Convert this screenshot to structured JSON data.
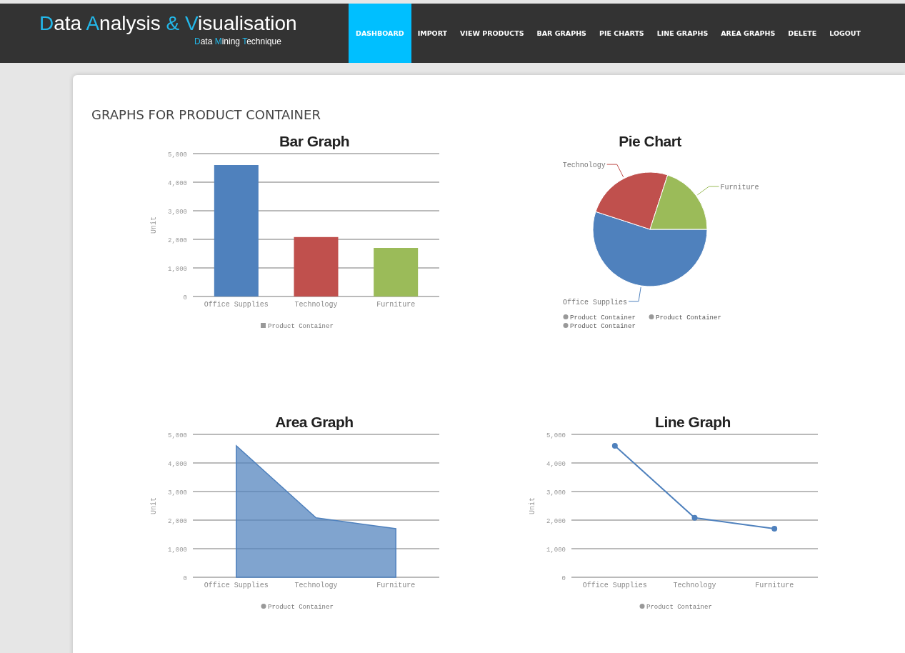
{
  "header": {
    "brand_parts": [
      {
        "text": "D",
        "accent": true
      },
      {
        "text": "ata ",
        "accent": false
      },
      {
        "text": "A",
        "accent": true
      },
      {
        "text": "nalysis ",
        "accent": false
      },
      {
        "text": "& ",
        "accent": true
      },
      {
        "text": "V",
        "accent": true
      },
      {
        "text": "isualisation",
        "accent": false
      }
    ],
    "tagline_parts": [
      {
        "text": "D",
        "accent": true
      },
      {
        "text": "ata ",
        "accent": false
      },
      {
        "text": "M",
        "accent": true
      },
      {
        "text": "ining ",
        "accent": false
      },
      {
        "text": "T",
        "accent": true
      },
      {
        "text": "echnique",
        "accent": false
      }
    ]
  },
  "nav": [
    {
      "label": "DASHBOARD",
      "selected": true
    },
    {
      "label": "IMPORT",
      "selected": false
    },
    {
      "label": "VIEW PRODUCTS",
      "selected": false
    },
    {
      "label": "BAR GRAPHS",
      "selected": false
    },
    {
      "label": "PIE CHARTS",
      "selected": false
    },
    {
      "label": "LINE GRAPHS",
      "selected": false
    },
    {
      "label": "AREA GRAPHS",
      "selected": false
    },
    {
      "label": "DELETE",
      "selected": false
    },
    {
      "label": "LOGOUT",
      "selected": false
    }
  ],
  "heading": "GRAPHS FOR PRODUCT CONTAINER",
  "charts": [
    {
      "chart_data": {
        "type": "bar",
        "title": "Bar Graph",
        "ylabel": "Unit",
        "categories": [
          "Office Supplies",
          "Technology",
          "Furniture"
        ],
        "colors": [
          "#4f81bd",
          "#c0504d",
          "#9bbb59"
        ],
        "grid": true,
        "series": [
          {
            "name": "Product Container",
            "values": [
              4600,
              2080,
              1700
            ]
          }
        ],
        "ylim": [
          0,
          5000
        ],
        "yticks": [
          {
            "value": 0,
            "label": "0"
          },
          {
            "value": 1000,
            "label": "1,000"
          },
          {
            "value": 2000,
            "label": "2,000"
          },
          {
            "value": 3000,
            "label": "3,000"
          },
          {
            "value": 4000,
            "label": "4,000"
          },
          {
            "value": 5000,
            "label": "5,000"
          }
        ]
      }
    },
    {
      "legend": [
        "Product Container",
        "Product Container",
        "Product Container"
      ],
      "chart_data": {
        "type": "pie",
        "title": "Pie Chart",
        "categories": [
          "Office Supplies",
          "Technology",
          "Furniture"
        ],
        "values": [
          55,
          25,
          20
        ],
        "colors": [
          "#4f81bd",
          "#c0504d",
          "#9bbb59"
        ]
      }
    },
    {
      "chart_data": {
        "type": "area",
        "title": "Area Graph",
        "ylabel": "Unit",
        "grid": true,
        "categories": [
          "Office Supplies",
          "Technology",
          "Furniture"
        ],
        "series": [
          {
            "name": "Product Container",
            "color": "#4f81bd",
            "values": [
              4600,
              2080,
              1700
            ]
          }
        ],
        "ylim": [
          0,
          5000
        ],
        "yticks": [
          {
            "value": 0,
            "label": "0"
          },
          {
            "value": 1000,
            "label": "1,000"
          },
          {
            "value": 2000,
            "label": "2,000"
          },
          {
            "value": 3000,
            "label": "3,000"
          },
          {
            "value": 4000,
            "label": "4,000"
          },
          {
            "value": 5000,
            "label": "5,000"
          }
        ]
      }
    },
    {
      "chart_data": {
        "type": "line",
        "title": "Line Graph",
        "ylabel": "Unit",
        "grid": true,
        "categories": [
          "Office Supplies",
          "Technology",
          "Furniture"
        ],
        "series": [
          {
            "name": "Product Container",
            "color": "#4f81bd",
            "marker": "circle",
            "values": [
              4600,
              2080,
              1700
            ]
          }
        ],
        "ylim": [
          0,
          5000
        ],
        "yticks": [
          {
            "value": 0,
            "label": "0"
          },
          {
            "value": 1000,
            "label": "1,000"
          },
          {
            "value": 2000,
            "label": "2,000"
          },
          {
            "value": 3000,
            "label": "3,000"
          },
          {
            "value": 4000,
            "label": "4,000"
          },
          {
            "value": 5000,
            "label": "5,000"
          }
        ]
      }
    }
  ]
}
